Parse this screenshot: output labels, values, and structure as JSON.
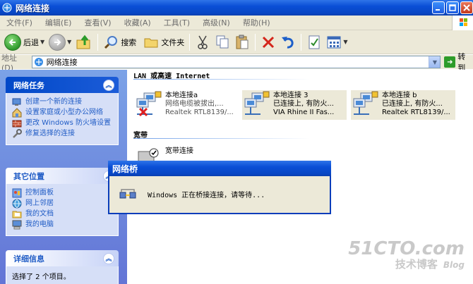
{
  "window": {
    "title": "网络连接"
  },
  "menu": {
    "items": [
      "文件(F)",
      "编辑(E)",
      "查看(V)",
      "收藏(A)",
      "工具(T)",
      "高级(N)",
      "帮助(H)"
    ]
  },
  "toolbar": {
    "back_label": "后退",
    "search_label": "搜索",
    "folders_label": "文件夹"
  },
  "address": {
    "label": "地址(D)",
    "value": "网络连接",
    "go_label": "转到"
  },
  "taskpane": {
    "network_tasks": {
      "title": "网络任务",
      "items": [
        "创建一个新的连接",
        "设置家庭或小型办公网络",
        "更改 Windows 防火墙设置",
        "修复选择的连接"
      ]
    },
    "other_places": {
      "title": "其它位置",
      "items": [
        "控制面板",
        "网上邻居",
        "我的文档",
        "我的电脑"
      ]
    },
    "details": {
      "title": "详细信息",
      "text": "选择了 2 个项目。"
    }
  },
  "content": {
    "lan_group": "LAN 或高速 Internet",
    "broadband_group": "宽带",
    "connections": [
      {
        "name": "本地连接a",
        "status": "网络电缆被拔出,...",
        "device": "Realtek RTL8139/...",
        "selected": false,
        "disconnected": true
      },
      {
        "name": "本地连接 3",
        "status": "已连接上, 有防火...",
        "device": "VIA Rhine II Fas...",
        "selected": true,
        "disconnected": false
      },
      {
        "name": "本地连接 b",
        "status": "已连接上, 有防火...",
        "device": "Realtek RTL8139/...",
        "selected": true,
        "disconnected": false
      }
    ],
    "broadband": {
      "name": "宽带连接"
    }
  },
  "dialog": {
    "title": "网络桥",
    "message": "Windows 正在桥接连接，请等待..."
  },
  "watermark": {
    "site": "51CTO.com",
    "sub": "技术博客",
    "blog": "Blog"
  },
  "colors": {
    "xp_blue": "#0a4fd6",
    "link_blue": "#215dc6",
    "panel_bg": "#d6dff7"
  }
}
